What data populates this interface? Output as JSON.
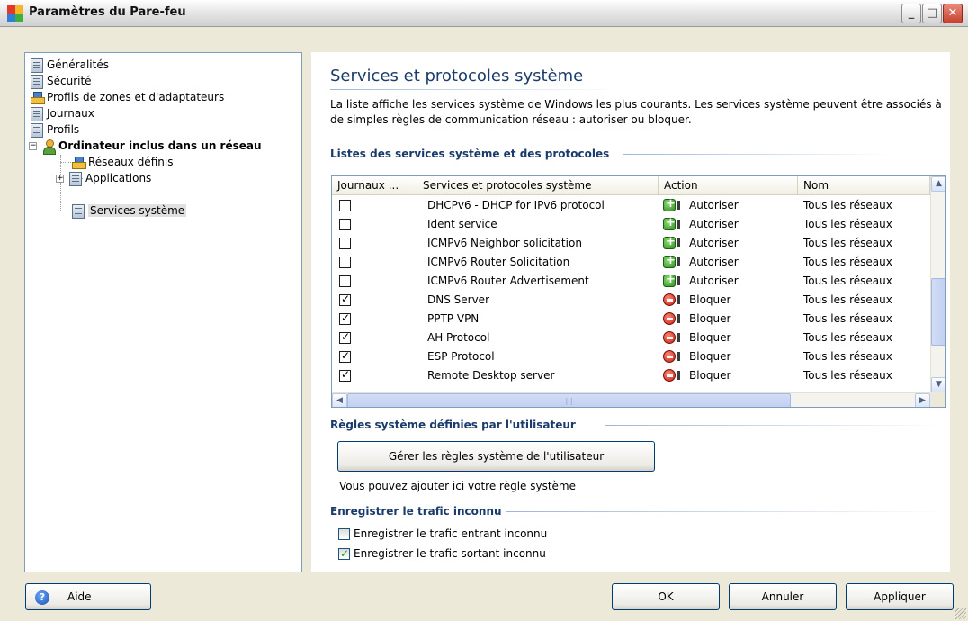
{
  "window": {
    "title": "Paramètres du Pare-feu",
    "minimize_glyph": "_",
    "maximize_glyph": "□",
    "close_glyph": "✕"
  },
  "tree": {
    "items": [
      {
        "label": "Généralités",
        "icon": "document-icon"
      },
      {
        "label": "Sécurité",
        "icon": "document-icon"
      },
      {
        "label": "Profils de zones et d'adaptateurs",
        "icon": "network-icon"
      },
      {
        "label": "Journaux",
        "icon": "document-icon"
      },
      {
        "label": "Profils",
        "icon": "document-icon"
      },
      {
        "label": "Ordinateur inclus dans un réseau",
        "icon": "person-icon",
        "expander": "−"
      },
      {
        "label": "Réseaux définis",
        "icon": "network-icon"
      },
      {
        "label": "Applications",
        "icon": "document-icon",
        "expander": "+"
      },
      {
        "label": "Services système",
        "icon": "document-icon"
      }
    ]
  },
  "main": {
    "title": "Services et protocoles système",
    "description": "La liste affiche les services système de Windows les plus courants. Les services système peuvent être associés à de simples règles de communication réseau : autoriser ou bloquer.",
    "list_section_title": "Listes des services système et des protocoles",
    "table": {
      "headers": [
        "Journaux ...",
        "Services et protocoles système",
        "Action",
        "Nom"
      ],
      "rows": [
        {
          "logged": false,
          "service": "DHCPv6 - DHCP for IPv6 protocol",
          "action": "Autoriser",
          "action_type": "allow",
          "name": "Tous les réseaux"
        },
        {
          "logged": false,
          "service": "Ident service",
          "action": "Autoriser",
          "action_type": "allow",
          "name": "Tous les réseaux"
        },
        {
          "logged": false,
          "service": "ICMPv6 Neighbor solicitation",
          "action": "Autoriser",
          "action_type": "allow",
          "name": "Tous les réseaux"
        },
        {
          "logged": false,
          "service": "ICMPv6 Router Solicitation",
          "action": "Autoriser",
          "action_type": "allow",
          "name": "Tous les réseaux"
        },
        {
          "logged": false,
          "service": "ICMPv6 Router Advertisement",
          "action": "Autoriser",
          "action_type": "allow",
          "name": "Tous les réseaux"
        },
        {
          "logged": true,
          "service": "DNS Server",
          "action": "Bloquer",
          "action_type": "block",
          "name": "Tous les réseaux"
        },
        {
          "logged": true,
          "service": "PPTP VPN",
          "action": "Bloquer",
          "action_type": "block",
          "name": "Tous les réseaux"
        },
        {
          "logged": true,
          "service": "AH Protocol",
          "action": "Bloquer",
          "action_type": "block",
          "name": "Tous les réseaux"
        },
        {
          "logged": true,
          "service": "ESP Protocol",
          "action": "Bloquer",
          "action_type": "block",
          "name": "Tous les réseaux"
        },
        {
          "logged": true,
          "service": "Remote Desktop server",
          "action": "Bloquer",
          "action_type": "block",
          "name": "Tous les réseaux"
        }
      ]
    },
    "user_rules_section_title": "Règles système définies par l'utilisateur",
    "manage_button": "Gérer les règles système de l'utilisateur",
    "hint": "Vous pouvez ajouter ici votre règle système",
    "unknown_traffic_section_title": "Enregistrer le trafic inconnu",
    "options": [
      {
        "label": "Enregistrer le trafic entrant inconnu",
        "checked": false
      },
      {
        "label": "Enregistrer le trafic sortant inconnu",
        "checked": true
      }
    ]
  },
  "footer": {
    "help_label": "Aide",
    "ok_label": "OK",
    "cancel_label": "Annuler",
    "apply_label": "Appliquer"
  },
  "colors": {
    "accent_title": "#1a3b6b",
    "allow": "#2f8f1f",
    "block": "#c81e10"
  }
}
